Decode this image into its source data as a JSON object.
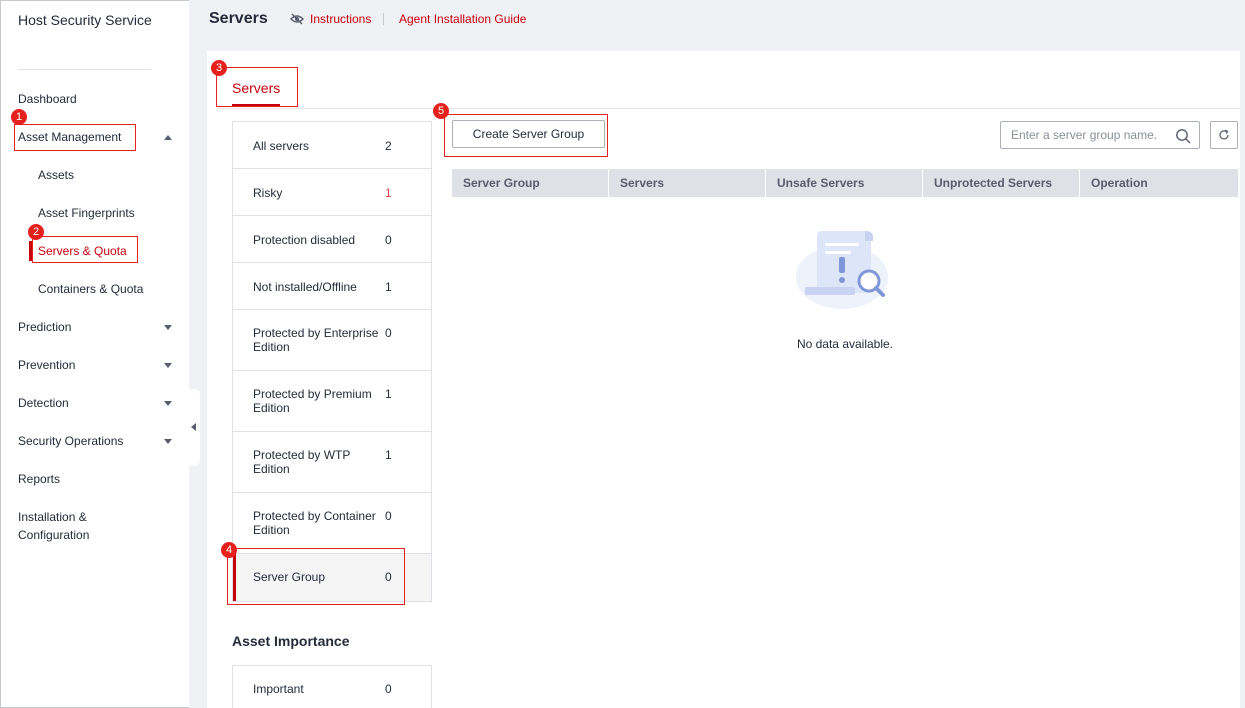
{
  "app": {
    "title": "Host Security Service"
  },
  "sidebar": {
    "items": [
      {
        "label": "Dashboard"
      },
      {
        "label": "Asset Management"
      },
      {
        "label": "Assets"
      },
      {
        "label": "Asset Fingerprints"
      },
      {
        "label": "Servers & Quota"
      },
      {
        "label": "Containers & Quota"
      },
      {
        "label": "Prediction"
      },
      {
        "label": "Prevention"
      },
      {
        "label": "Detection"
      },
      {
        "label": "Security Operations"
      },
      {
        "label": "Reports"
      },
      {
        "label": "Installation & Configuration"
      }
    ]
  },
  "header": {
    "title": "Servers",
    "instructions_link": "Instructions",
    "agent_guide_link": "Agent Installation Guide"
  },
  "tabs": {
    "servers": "Servers"
  },
  "categories": [
    {
      "label": "All servers",
      "count": "2"
    },
    {
      "label": "Risky",
      "count": "1"
    },
    {
      "label": "Protection disabled",
      "count": "0"
    },
    {
      "label": "Not installed/Offline",
      "count": "1"
    },
    {
      "label": "Protected by Enterprise Edition",
      "count": "0"
    },
    {
      "label": "Protected by Premium Edition",
      "count": "1"
    },
    {
      "label": "Protected by WTP Edition",
      "count": "1"
    },
    {
      "label": "Protected by Container Edition",
      "count": "0"
    },
    {
      "label": "Server Group",
      "count": "0"
    }
  ],
  "asset_importance": {
    "title": "Asset Importance",
    "items": [
      {
        "label": "Important",
        "count": "0"
      }
    ]
  },
  "toolbar": {
    "create_group_label": "Create Server Group",
    "search_placeholder": "Enter a server group name."
  },
  "table": {
    "columns": [
      "Server Group",
      "Servers",
      "Unsafe Servers",
      "Unprotected Servers",
      "Operation"
    ],
    "empty_text": "No data available."
  },
  "callouts": [
    "1",
    "2",
    "3",
    "4",
    "5"
  ],
  "colors": {
    "accent": "#c7000b",
    "callout": "#e5201d",
    "risky": "#e54545"
  }
}
